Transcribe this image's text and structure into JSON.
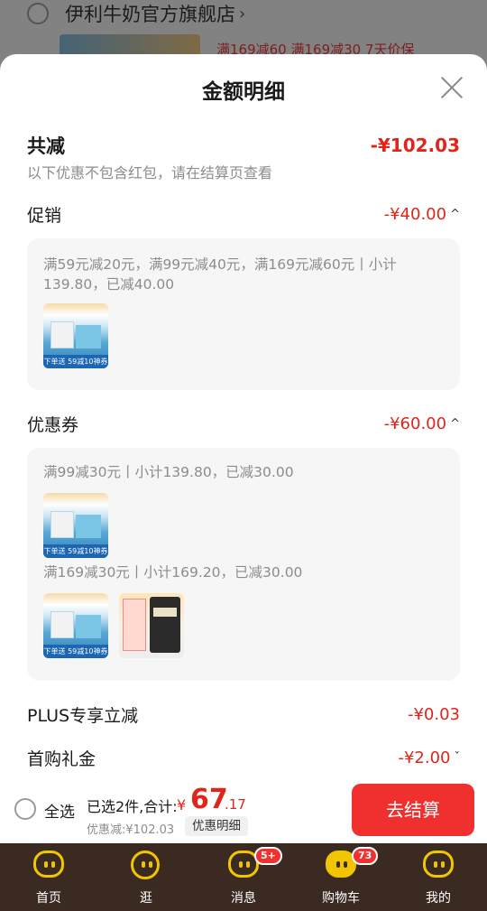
{
  "background": {
    "shop_name": "伊利牛奶官方旗舰店",
    "shop_chevron": "›",
    "promo_text": "满169减60  满169减30  7天价保"
  },
  "sheet": {
    "title": "金额明细",
    "total": {
      "label": "共减",
      "value": "-¥102.03"
    },
    "note": "以下优惠不包含红包，请在结算页查看",
    "promotion": {
      "label": "促销",
      "value": "-¥40.00",
      "rule": "满59元减20元，满99元减40元，满169元减60元丨小计139.80，已减40.00",
      "thumb_caption": "下单送 59减10神券"
    },
    "coupon": {
      "label": "优惠券",
      "value": "-¥60.00",
      "items": [
        {
          "rule": "满99减30元丨小计139.80，已减30.00",
          "thumb_caption": "下单送 59减10神券"
        },
        {
          "rule": "满169减30元丨小计169.20，已减30.00",
          "thumb_caption": "下单送 59减10神券"
        }
      ]
    },
    "plus": {
      "label": "PLUS专享立减",
      "value": "-¥0.03"
    },
    "first_gift": {
      "label": "首购礼金",
      "value": "-¥2.00"
    },
    "caret_up": "^",
    "caret_down": "ˇ"
  },
  "bottom": {
    "select_all": "全选",
    "selected": "已选2件,合计:",
    "yen": "¥",
    "total_int": "67",
    "total_dec": ".17",
    "discount": "优惠减:¥102.03",
    "detail_button": "优惠明细",
    "checkout": "去结算"
  },
  "tabbar": [
    {
      "label": "首页",
      "icon": "home-face-icon",
      "badge": ""
    },
    {
      "label": "逛",
      "icon": "browse-icon",
      "badge": ""
    },
    {
      "label": "消息",
      "icon": "message-icon",
      "badge": "5+"
    },
    {
      "label": "购物车",
      "icon": "cart-icon",
      "badge": "73"
    },
    {
      "label": "我的",
      "icon": "profile-icon",
      "badge": ""
    }
  ],
  "colors": {
    "accent": "#e1251b",
    "checkout": "#f0302e",
    "tabbar": "#3a2a22",
    "tab_icon": "#f1c500"
  }
}
